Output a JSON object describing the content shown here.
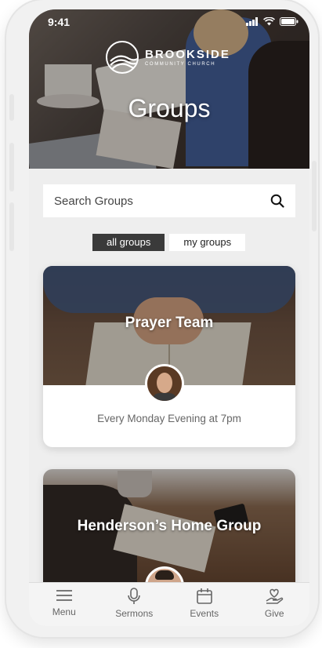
{
  "status": {
    "time": "9:41"
  },
  "brand": {
    "name": "BROOKSIDE",
    "subtitle": "COMMUNITY CHURCH"
  },
  "header": {
    "title": "Groups"
  },
  "search": {
    "placeholder": "Search Groups"
  },
  "tabs": [
    {
      "label": "all groups",
      "active": true
    },
    {
      "label": "my groups",
      "active": false
    }
  ],
  "groups": [
    {
      "title": "Prayer Team",
      "schedule": "Every Monday Evening at 7pm"
    },
    {
      "title": "Henderson’s Home Group",
      "schedule": ""
    }
  ],
  "nav": [
    {
      "label": "Menu",
      "icon": "menu-icon"
    },
    {
      "label": "Sermons",
      "icon": "microphone-icon"
    },
    {
      "label": "Events",
      "icon": "calendar-icon"
    },
    {
      "label": "Give",
      "icon": "give-heart-hand-icon"
    }
  ],
  "colors": {
    "active_tab": "#3a3a3a",
    "background": "#eeeeee",
    "card": "#ffffff"
  }
}
